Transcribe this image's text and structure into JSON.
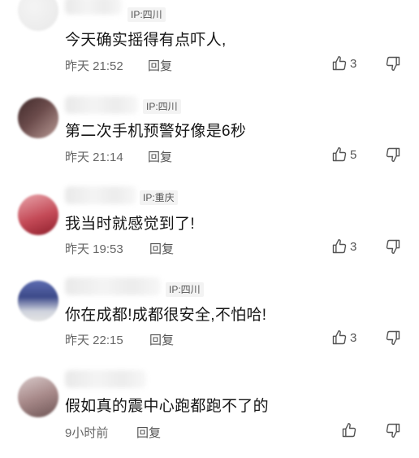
{
  "comments": [
    {
      "ip": "IP:四川",
      "text": "今天确实摇得有点吓人,",
      "time": "昨天 21:52",
      "reply_label": "回复",
      "likes": "3",
      "avatar_colors": [
        "#f2f2f2",
        "#ececec"
      ]
    },
    {
      "ip": "IP:四川",
      "text": "第二次手机预警好像是6秒",
      "time": "昨天 21:14",
      "reply_label": "回复",
      "likes": "5",
      "avatar_colors": [
        "#6b4b4b",
        "#b89a95"
      ]
    },
    {
      "ip": "IP:重庆",
      "text": "我当时就感觉到了!",
      "time": "昨天 19:53",
      "reply_label": "回复",
      "likes": "3",
      "avatar_colors": [
        "#b23a48",
        "#e5a9ad"
      ]
    },
    {
      "ip": "IP:四川",
      "text": "你在成都!成都很安全,不怕哈!",
      "time": "昨天 22:15",
      "reply_label": "回复",
      "likes": "3",
      "avatar_colors": [
        "#4a5a9c",
        "#c9cdd8"
      ]
    },
    {
      "ip": "",
      "text": "假如真的震中心跑都跑不了的",
      "time": "9小时前",
      "reply_label": "回复",
      "likes": "",
      "avatar_colors": [
        "#8a6e6e",
        "#d8c9c9"
      ]
    }
  ]
}
